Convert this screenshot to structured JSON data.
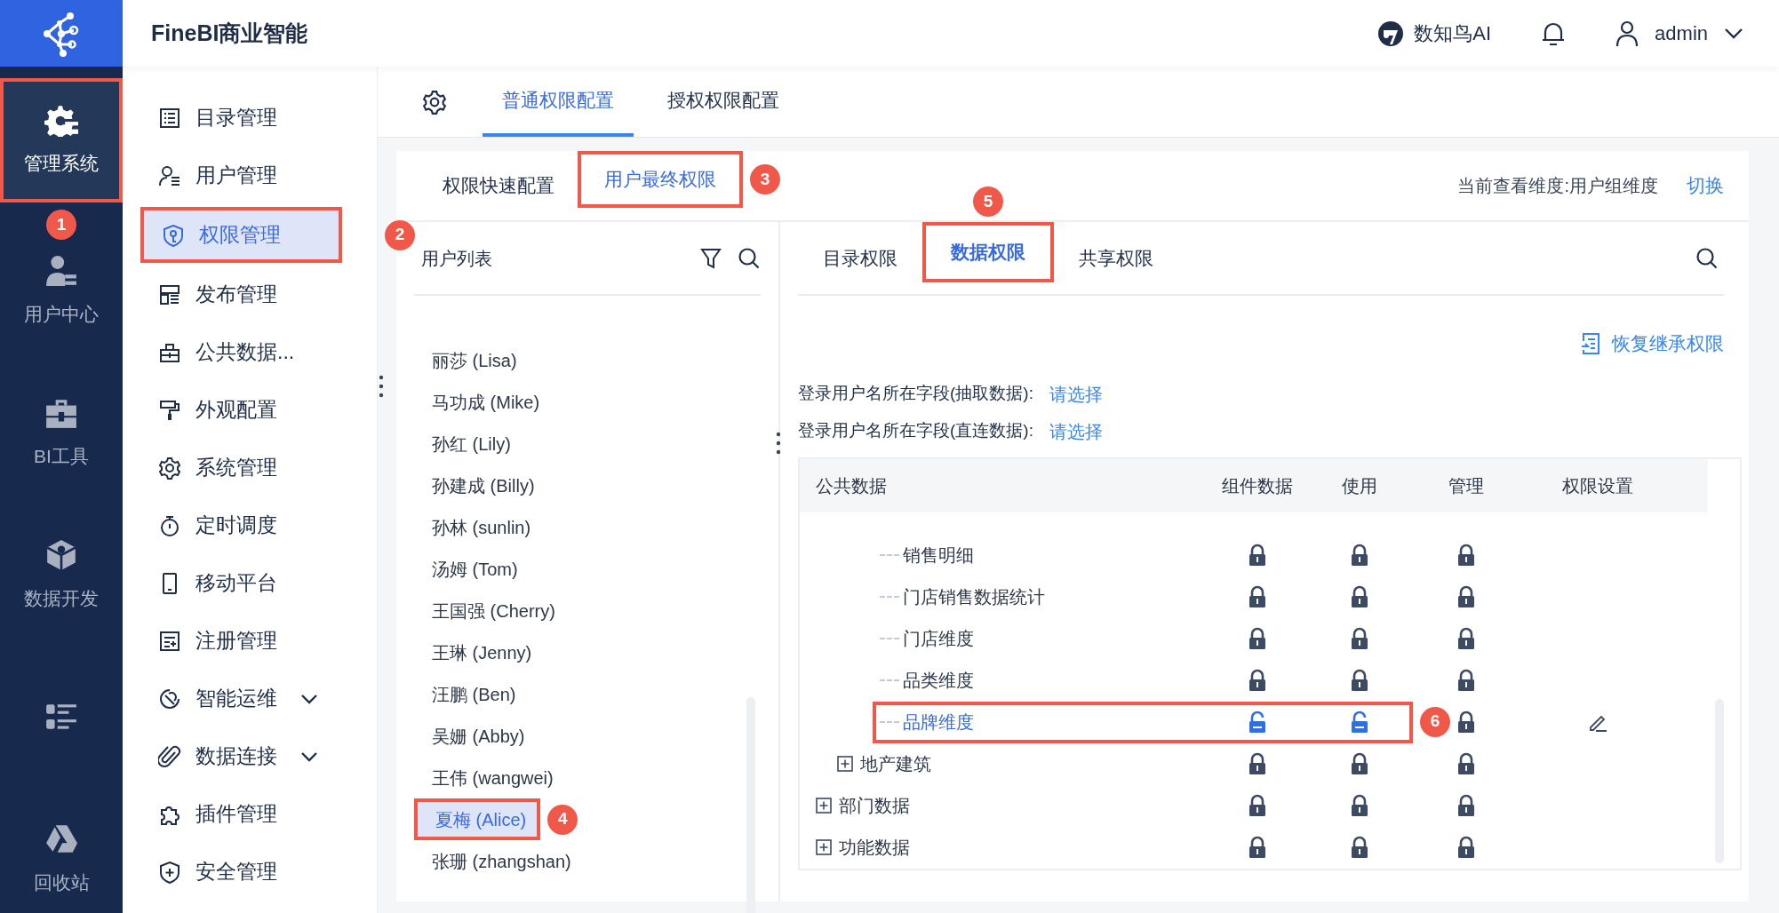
{
  "app": {
    "title": "FineBI商业智能"
  },
  "rail": [
    {
      "label": "管理系统",
      "selected": true,
      "callout": "1"
    },
    {
      "label": "用户中心",
      "selected": false
    },
    {
      "label": "BI工具",
      "selected": false
    },
    {
      "label": "数据开发",
      "selected": false
    },
    {
      "selected": false
    },
    {
      "label": "回收站",
      "selected": false
    }
  ],
  "header": {
    "assistant": "数知鸟AI",
    "user": "admin"
  },
  "menu": [
    {
      "label": "目录管理",
      "selected": false
    },
    {
      "label": "用户管理",
      "selected": false
    },
    {
      "label": "权限管理",
      "selected": true,
      "callout": "2"
    },
    {
      "label": "发布管理",
      "selected": false
    },
    {
      "label": "公共数据...",
      "selected": false
    },
    {
      "label": "外观配置",
      "selected": false
    },
    {
      "label": "系统管理",
      "selected": false
    },
    {
      "label": "定时调度",
      "selected": false
    },
    {
      "label": "移动平台",
      "selected": false
    },
    {
      "label": "注册管理",
      "selected": false
    },
    {
      "label": "智能运维",
      "selected": false,
      "expanded": false
    },
    {
      "label": "数据连接",
      "selected": false,
      "expanded": false
    },
    {
      "label": "插件管理",
      "selected": false
    },
    {
      "label": "安全管理",
      "selected": false
    }
  ],
  "config_tabs": [
    {
      "label": "普通权限配置",
      "selected": true
    },
    {
      "label": "授权权限配置",
      "selected": false
    }
  ],
  "view_tabs": [
    {
      "label": "权限快速配置",
      "selected": false
    },
    {
      "label": "用户最终权限",
      "selected": true,
      "callout": "3"
    }
  ],
  "dimension": {
    "label": "当前查看维度:用户组维度",
    "action": "切换"
  },
  "user_list": {
    "title": "用户列表",
    "users": [
      {
        "label": "丽莎 (Lisa)",
        "selected": false
      },
      {
        "label": "马功成 (Mike)",
        "selected": false
      },
      {
        "label": "孙红 (Lily)",
        "selected": false
      },
      {
        "label": "孙建成 (Billy)",
        "selected": false
      },
      {
        "label": "孙林 (sunlin)",
        "selected": false
      },
      {
        "label": "汤姆 (Tom)",
        "selected": false
      },
      {
        "label": "王国强 (Cherry)",
        "selected": false
      },
      {
        "label": "王琳 (Jenny)",
        "selected": false
      },
      {
        "label": "汪鹏 (Ben)",
        "selected": false
      },
      {
        "label": "吴姗 (Abby)",
        "selected": false
      },
      {
        "label": "王伟 (wangwei)",
        "selected": false
      },
      {
        "label": "夏梅 (Alice)",
        "selected": true,
        "callout": "4"
      },
      {
        "label": "张珊 (zhangshan)",
        "selected": false
      }
    ]
  },
  "perm_tabs": [
    {
      "label": "目录权限",
      "selected": false
    },
    {
      "label": "数据权限",
      "selected": true,
      "callout": "5"
    },
    {
      "label": "共享权限",
      "selected": false
    }
  ],
  "restore": "恢复继承权限",
  "fields": [
    {
      "label": "登录用户名所在字段(抽取数据):",
      "value": "请选择"
    },
    {
      "label": "登录用户名所在字段(直连数据):",
      "value": "请选择"
    }
  ],
  "table": {
    "columns": [
      "公共数据",
      "组件数据",
      "使用",
      "管理",
      "权限设置"
    ],
    "tree": [
      {
        "children": [
          {
            "children": [
              {
                "children": [
                  {
                    "label": "销售明细",
                    "selected": false,
                    "locks": [
                      true,
                      true,
                      true
                    ],
                    "editable": false
                  },
                  {
                    "label": "门店销售数据统计",
                    "selected": false,
                    "locks": [
                      true,
                      true,
                      true
                    ],
                    "editable": false
                  },
                  {
                    "label": "门店维度",
                    "selected": false,
                    "locks": [
                      true,
                      true,
                      true
                    ],
                    "editable": false
                  },
                  {
                    "label": "品类维度",
                    "selected": false,
                    "locks": [
                      true,
                      true,
                      true
                    ],
                    "editable": false
                  },
                  {
                    "label": "品牌维度",
                    "selected": true,
                    "locks": [
                      false,
                      false,
                      true
                    ],
                    "editable": true,
                    "callout": "6"
                  }
                ]
              }
            ]
          },
          {
            "label": "地产建筑",
            "selected": false,
            "expanded": false,
            "locks": [
              true,
              true,
              true
            ],
            "editable": false
          }
        ]
      },
      {
        "label": "部门数据",
        "selected": false,
        "expanded": false,
        "locks": [
          true,
          true,
          true
        ],
        "editable": false
      },
      {
        "label": "功能数据",
        "selected": false,
        "expanded": false,
        "locks": [
          true,
          true,
          true
        ],
        "editable": false
      }
    ]
  }
}
